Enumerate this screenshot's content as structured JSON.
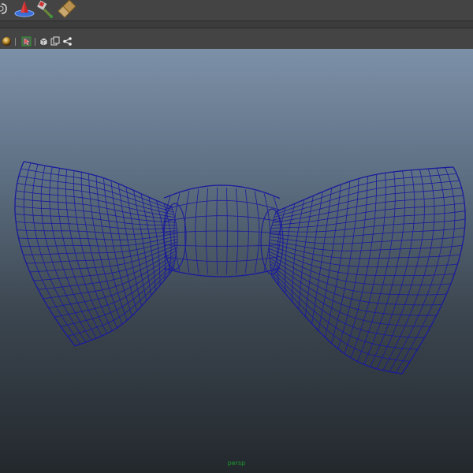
{
  "shelf": {
    "icons": [
      "shelf-partial-icon",
      "render-cone-icon",
      "paint-tool-icon",
      "hypershade-icon"
    ]
  },
  "panel_toolbar": {
    "icons": [
      "shaded-sphere-icon",
      "select-camera-icon",
      "cube-view-icon",
      "copy-view-icon",
      "share-icon"
    ]
  },
  "viewport": {
    "camera_label": "persp",
    "object": "bow-tie-wireframe",
    "colors": {
      "wire": "#1a1a9c",
      "background_top": "#7c90a8",
      "background_bottom": "#23282d",
      "camera_label": "#1a9a2a"
    }
  }
}
